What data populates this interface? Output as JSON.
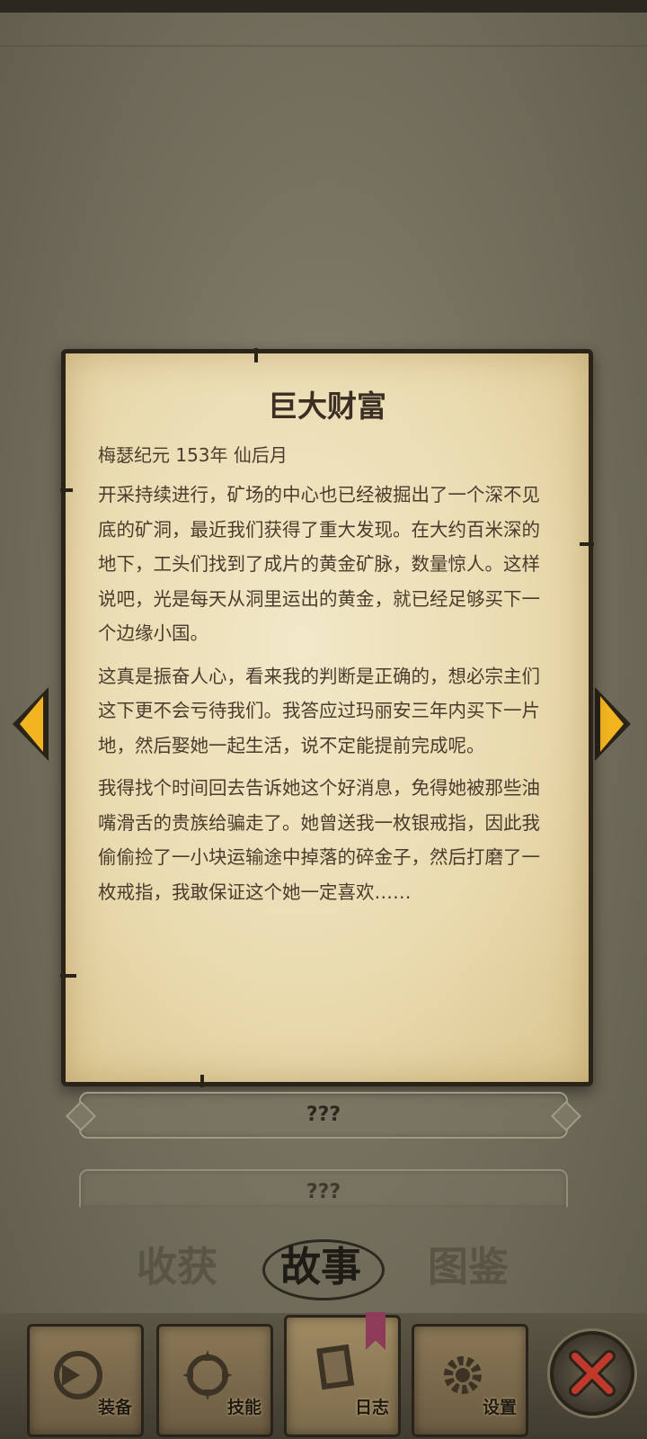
{
  "story": {
    "title": "巨大财富",
    "date": "梅瑟纪元 153年 仙后月",
    "paragraphs": [
      "开采持续进行，矿场的中心也已经被掘出了一个深不见底的矿洞，最近我们获得了重大发现。在大约百米深的地下，工头们找到了成片的黄金矿脉，数量惊人。这样说吧，光是每天从洞里运出的黄金，就已经足够买下一个边缘小国。",
      "这真是振奋人心，看来我的判断是正确的，想必宗主们这下更不会亏待我们。我答应过玛丽安三年内买下一片地，然后娶她一起生活，说不定能提前完成呢。",
      "我得找个时间回去告诉她这个好消息，免得她被那些油嘴滑舌的贵族给骗走了。她曾送我一枚银戒指，因此我偷偷捡了一小块运输途中掉落的碎金子，然后打磨了一枚戒指，我敢保证这个她一定喜欢……"
    ]
  },
  "entries": [
    "???",
    "???"
  ],
  "tabs": [
    "收获",
    "故事",
    "图鉴"
  ],
  "toolbar": [
    "装备",
    "技能",
    "日志",
    "设置"
  ],
  "colors": {
    "arrow": "#f2b51f",
    "parchment": "#eadbb0",
    "ink": "#4a3d2e",
    "bookmark": "#8e3b5a",
    "close": "#c0392b"
  }
}
